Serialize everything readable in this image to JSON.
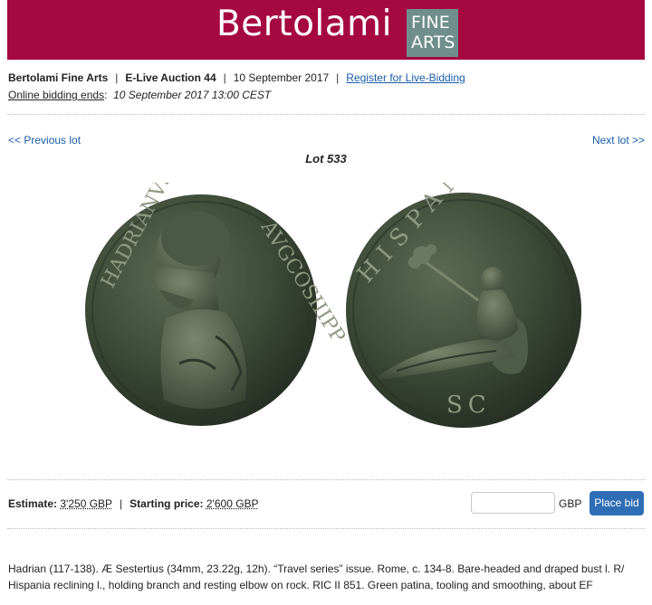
{
  "header": {
    "brand_name": "Bertolami",
    "brand_box_line1": "FINE",
    "brand_box_line2": "ARTS",
    "brand_color": "#a5093f",
    "brand_box_color": "#6f8e8c"
  },
  "auction_info": {
    "house": "Bertolami Fine Arts",
    "auction": "E-Live Auction 44",
    "date": "10 September 2017",
    "register_link": "Register for Live-Bidding",
    "ends_label": "Online bidding ends",
    "ends_value": "10 September 2017 13:00 CEST"
  },
  "navigation": {
    "prev_label": "<< Previous lot",
    "next_label": "Next lot >>",
    "lot_title": "Lot 533"
  },
  "coin": {
    "obverse_legend_left": "HADRIANVS",
    "obverse_legend_right": "AVGCOSIIIPP",
    "reverse_legend": "HISPANIA",
    "reverse_exergue": "SC",
    "patina_color": "#3e4c38"
  },
  "bidding": {
    "estimate_label": "Estimate:",
    "estimate_value": "3'250 GBP",
    "starting_label": "Starting price:",
    "starting_value": "2'600 GBP",
    "input_value": "",
    "currency": "GBP",
    "button_label": "Place bid",
    "button_color": "#2f6eb5"
  },
  "description": "Hadrian (117-138). Æ Sestertius (34mm, 23.22g, 12h). “Travel series” issue. Rome, c. 134-8. Bare-headed and draped bust l. R/ Hispania reclining l., holding branch and resting elbow on rock. RIC II 851. Green patina, tooling and smoothing, about EF"
}
